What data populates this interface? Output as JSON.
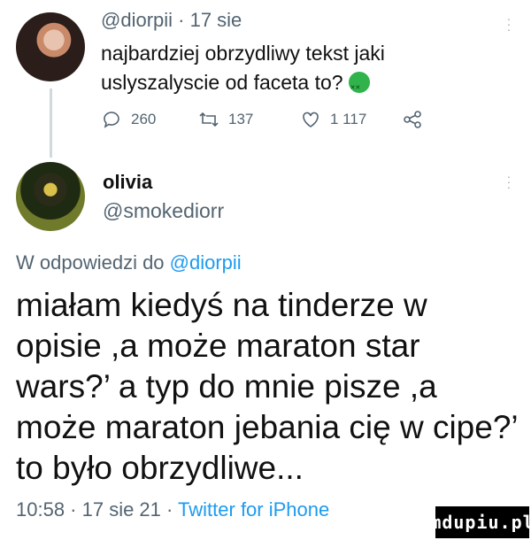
{
  "tweet1": {
    "handle_time": "@diorpii · 17 sie",
    "text_line1": "najbardziej obrzydliwy tekst jaki",
    "text_line2": "uslyszalyscie od faceta to?",
    "emoji_icon": "nauseated-face-icon",
    "actions": {
      "replies": "260",
      "retweets": "137",
      "likes": "1 117"
    }
  },
  "tweet2": {
    "name": "olivia",
    "handle": "@smokediorr",
    "reply_prefix": "W odpowiedzi do ",
    "reply_handle": "@diorpii",
    "text_lines": [
      "miałam kiedyś na tinderze w",
      "opisie ,a może maraton star",
      "wars?’ a typ do mnie pisze ,a",
      "może maraton jebania cię w cipe?’",
      "to było obrzydliwe..."
    ],
    "time_date": "10:58 · 17 sie 21 · ",
    "source": "Twitter for iPhone"
  },
  "watermark": "mdupiu.pl",
  "colors": {
    "link": "#1d9bf0",
    "muted": "#536471",
    "text": "#111111"
  }
}
